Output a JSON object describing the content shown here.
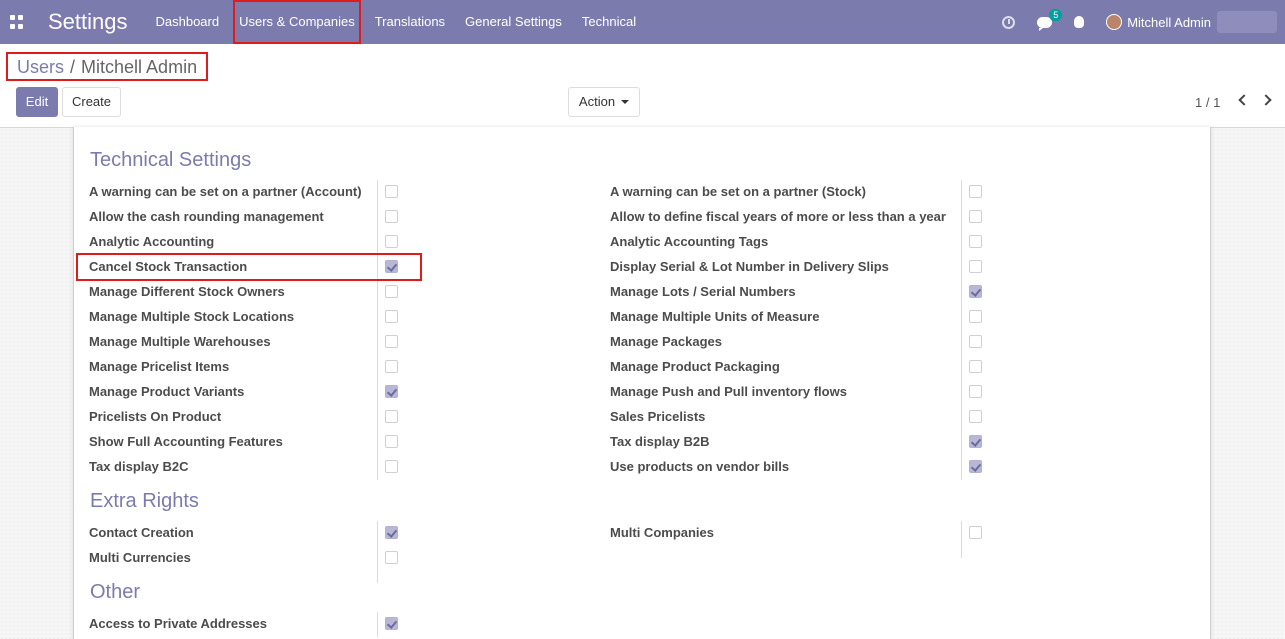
{
  "navbar": {
    "brand": "Settings",
    "menu": [
      "Dashboard",
      "Users & Companies",
      "Translations",
      "General Settings",
      "Technical"
    ],
    "messages_badge": "5",
    "user_name": "Mitchell Admin",
    "color": "#7c7bad"
  },
  "breadcrumb": {
    "parent": "Users",
    "current": "Mitchell Admin"
  },
  "toolbar": {
    "edit_label": "Edit",
    "create_label": "Create",
    "action_label": "Action",
    "pager": "1 / 1"
  },
  "technical_settings": {
    "title": "Technical Settings",
    "left": [
      {
        "label": "A warning can be set on a partner (Account)",
        "checked": false
      },
      {
        "label": "Allow the cash rounding management",
        "checked": false
      },
      {
        "label": "Analytic Accounting",
        "checked": false
      },
      {
        "label": "Cancel Stock Transaction",
        "checked": true
      },
      {
        "label": "Manage Different Stock Owners",
        "checked": false
      },
      {
        "label": "Manage Multiple Stock Locations",
        "checked": false
      },
      {
        "label": "Manage Multiple Warehouses",
        "checked": false
      },
      {
        "label": "Manage Pricelist Items",
        "checked": false
      },
      {
        "label": "Manage Product Variants",
        "checked": true
      },
      {
        "label": "Pricelists On Product",
        "checked": false
      },
      {
        "label": "Show Full Accounting Features",
        "checked": false
      },
      {
        "label": "Tax display B2C",
        "checked": false
      }
    ],
    "right": [
      {
        "label": "A warning can be set on a partner (Stock)",
        "checked": false
      },
      {
        "label": "Allow to define fiscal years of more or less than a year",
        "checked": false
      },
      {
        "label": "Analytic Accounting Tags",
        "checked": false
      },
      {
        "label": "Display Serial & Lot Number in Delivery Slips",
        "checked": false
      },
      {
        "label": "Manage Lots / Serial Numbers",
        "checked": true
      },
      {
        "label": "Manage Multiple Units of Measure",
        "checked": false
      },
      {
        "label": "Manage Packages",
        "checked": false
      },
      {
        "label": "Manage Product Packaging",
        "checked": false
      },
      {
        "label": "Manage Push and Pull inventory flows",
        "checked": false
      },
      {
        "label": "Sales Pricelists",
        "checked": false
      },
      {
        "label": "Tax display B2B",
        "checked": true
      },
      {
        "label": "Use products on vendor bills",
        "checked": true
      }
    ]
  },
  "extra_rights": {
    "title": "Extra Rights",
    "left": [
      {
        "label": "Contact Creation",
        "checked": true
      },
      {
        "label": "Multi Currencies",
        "checked": false
      }
    ],
    "right": [
      {
        "label": "Multi Companies",
        "checked": false
      }
    ]
  },
  "other": {
    "title": "Other",
    "left": [
      {
        "label": "Access to Private Addresses",
        "checked": true
      }
    ]
  }
}
